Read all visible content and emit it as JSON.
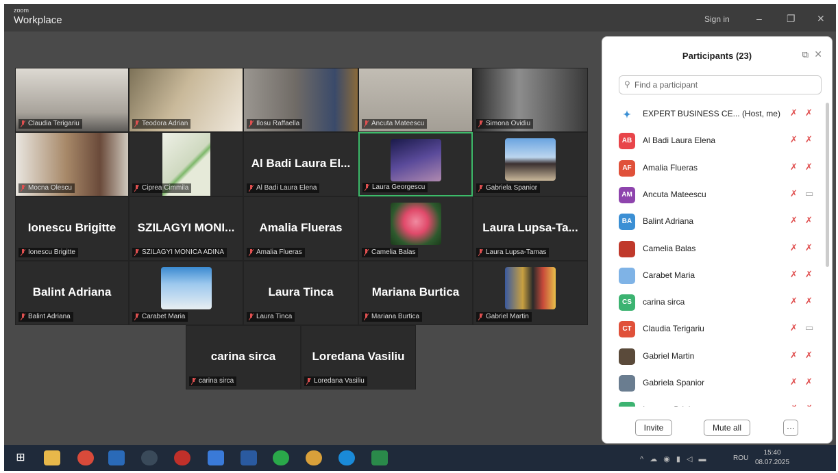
{
  "window": {
    "brand_small": "zoom",
    "brand": "Workplace",
    "sign_in": "Sign in",
    "minimize": "–",
    "restore": "❐",
    "close": "✕"
  },
  "gallery": {
    "tiles": [
      {
        "label": "Claudia Terigariu"
      },
      {
        "label": "Teodora Adrian"
      },
      {
        "label": "Ilosu Raffaella"
      },
      {
        "label": "Ancuta Mateescu"
      },
      {
        "label": "Simona Ovidiu"
      },
      {
        "label": "Mocna Olescu"
      },
      {
        "label": "Ciprea Cimmila"
      },
      {
        "big": "Al Badi Laura El...",
        "label": "Al Badi Laura Elena"
      },
      {
        "label": "Laura Georgescu"
      },
      {
        "label": "Gabriela Spanior"
      },
      {
        "big": "Ionescu Brigitte",
        "label": "Ionescu Brigitte"
      },
      {
        "big": "SZILAGYI MONI...",
        "label": "SZILAGYI MONICA ADINA"
      },
      {
        "big": "Amalia Flueras",
        "label": "Amalia Flueras"
      },
      {
        "label": "Camelia Balas"
      },
      {
        "big": "Laura Lupsa-Ta...",
        "label": "Laura Lupsa-Tamas"
      },
      {
        "big": "Balint Adriana",
        "label": "Balint Adriana"
      },
      {
        "label": "Carabet Maria"
      },
      {
        "big": "Laura Tinca",
        "label": "Laura Tinca"
      },
      {
        "big": "Mariana Burtica",
        "label": "Mariana Burtica"
      },
      {
        "label": "Gabriel Martin"
      },
      {
        "big": "carina sirca",
        "label": "carina sirca"
      },
      {
        "big": "Loredana Vasiliu",
        "label": "Loredana Vasiliu"
      }
    ]
  },
  "participants": {
    "title": "Participants (23)",
    "popout_icon": "⧉",
    "close_icon": "✕",
    "search_placeholder": "Find a participant",
    "search_icon": "⚲",
    "list": [
      {
        "initials": "",
        "name": "EXPERT BUSINESS CE...  (Host, me)",
        "color": "#ffffff",
        "mic": "✗",
        "cam": "✗"
      },
      {
        "initials": "AB",
        "name": "Al Badi Laura Elena",
        "color": "#e8454a",
        "mic": "✗",
        "cam": "✗"
      },
      {
        "initials": "AF",
        "name": "Amalia Flueras",
        "color": "#e0513a",
        "mic": "✗",
        "cam": "✗"
      },
      {
        "initials": "AM",
        "name": "Ancuta Mateescu",
        "color": "#8e44ad",
        "mic": "✗",
        "cam": "▭"
      },
      {
        "initials": "BA",
        "name": "Balint Adriana",
        "color": "#3b8fd4",
        "mic": "✗",
        "cam": "✗"
      },
      {
        "initials": "",
        "name": "Camelia Balas",
        "color": "#c0392b",
        "mic": "✗",
        "cam": "✗"
      },
      {
        "initials": "",
        "name": "Carabet Maria",
        "color": "#7fb3e6",
        "mic": "✗",
        "cam": "✗"
      },
      {
        "initials": "CS",
        "name": "carina sirca",
        "color": "#3cb371",
        "mic": "✗",
        "cam": "✗"
      },
      {
        "initials": "CT",
        "name": "Claudia Terigariu",
        "color": "#e0513a",
        "mic": "✗",
        "cam": "▭"
      },
      {
        "initials": "",
        "name": "Gabriel Martin",
        "color": "#5a4a3a",
        "mic": "✗",
        "cam": "✗"
      },
      {
        "initials": "",
        "name": "Gabriela Spanior",
        "color": "#6a7d90",
        "mic": "✗",
        "cam": "✗"
      },
      {
        "initials": "IB",
        "name": "Ionescu Brigitte",
        "color": "#3cb371",
        "mic": "✗",
        "cam": "✗"
      }
    ],
    "invite": "Invite",
    "mute_all": "Mute all",
    "more": "···"
  },
  "taskbar": {
    "start": "⊞",
    "tray": "^ ☁ ◉ ▮ ◁ ▬",
    "language": "ROU",
    "time": "15:40",
    "date": "08.07.2025"
  }
}
